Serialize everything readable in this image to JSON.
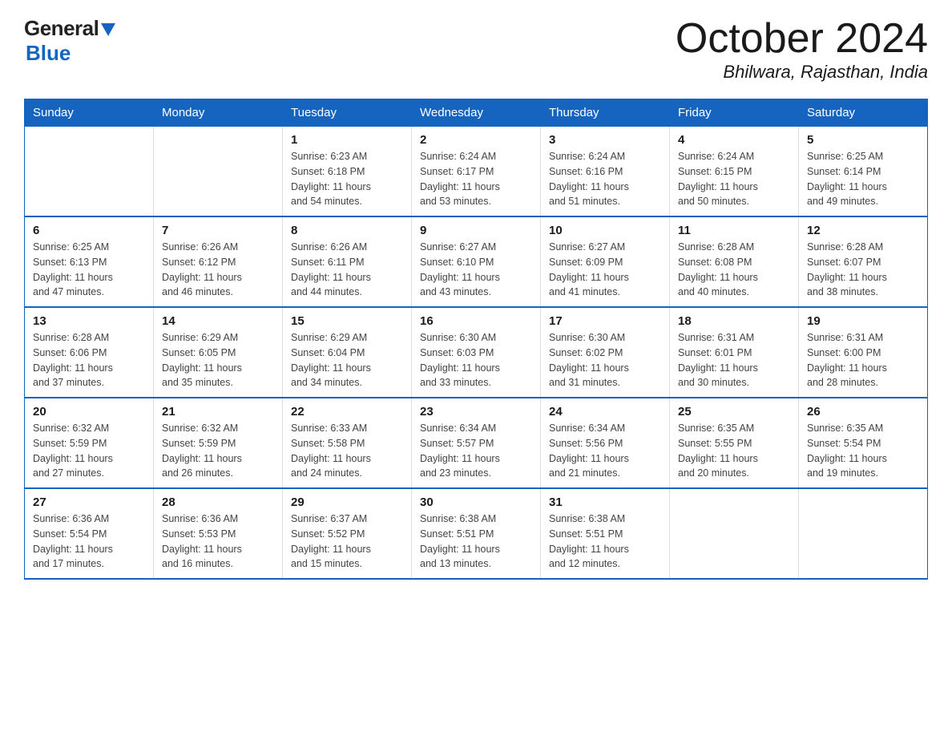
{
  "logo": {
    "general": "General",
    "blue": "Blue"
  },
  "title": "October 2024",
  "location": "Bhilwara, Rajasthan, India",
  "weekdays": [
    "Sunday",
    "Monday",
    "Tuesday",
    "Wednesday",
    "Thursday",
    "Friday",
    "Saturday"
  ],
  "weeks": [
    [
      {
        "day": "",
        "info": ""
      },
      {
        "day": "",
        "info": ""
      },
      {
        "day": "1",
        "info": "Sunrise: 6:23 AM\nSunset: 6:18 PM\nDaylight: 11 hours\nand 54 minutes."
      },
      {
        "day": "2",
        "info": "Sunrise: 6:24 AM\nSunset: 6:17 PM\nDaylight: 11 hours\nand 53 minutes."
      },
      {
        "day": "3",
        "info": "Sunrise: 6:24 AM\nSunset: 6:16 PM\nDaylight: 11 hours\nand 51 minutes."
      },
      {
        "day": "4",
        "info": "Sunrise: 6:24 AM\nSunset: 6:15 PM\nDaylight: 11 hours\nand 50 minutes."
      },
      {
        "day": "5",
        "info": "Sunrise: 6:25 AM\nSunset: 6:14 PM\nDaylight: 11 hours\nand 49 minutes."
      }
    ],
    [
      {
        "day": "6",
        "info": "Sunrise: 6:25 AM\nSunset: 6:13 PM\nDaylight: 11 hours\nand 47 minutes."
      },
      {
        "day": "7",
        "info": "Sunrise: 6:26 AM\nSunset: 6:12 PM\nDaylight: 11 hours\nand 46 minutes."
      },
      {
        "day": "8",
        "info": "Sunrise: 6:26 AM\nSunset: 6:11 PM\nDaylight: 11 hours\nand 44 minutes."
      },
      {
        "day": "9",
        "info": "Sunrise: 6:27 AM\nSunset: 6:10 PM\nDaylight: 11 hours\nand 43 minutes."
      },
      {
        "day": "10",
        "info": "Sunrise: 6:27 AM\nSunset: 6:09 PM\nDaylight: 11 hours\nand 41 minutes."
      },
      {
        "day": "11",
        "info": "Sunrise: 6:28 AM\nSunset: 6:08 PM\nDaylight: 11 hours\nand 40 minutes."
      },
      {
        "day": "12",
        "info": "Sunrise: 6:28 AM\nSunset: 6:07 PM\nDaylight: 11 hours\nand 38 minutes."
      }
    ],
    [
      {
        "day": "13",
        "info": "Sunrise: 6:28 AM\nSunset: 6:06 PM\nDaylight: 11 hours\nand 37 minutes."
      },
      {
        "day": "14",
        "info": "Sunrise: 6:29 AM\nSunset: 6:05 PM\nDaylight: 11 hours\nand 35 minutes."
      },
      {
        "day": "15",
        "info": "Sunrise: 6:29 AM\nSunset: 6:04 PM\nDaylight: 11 hours\nand 34 minutes."
      },
      {
        "day": "16",
        "info": "Sunrise: 6:30 AM\nSunset: 6:03 PM\nDaylight: 11 hours\nand 33 minutes."
      },
      {
        "day": "17",
        "info": "Sunrise: 6:30 AM\nSunset: 6:02 PM\nDaylight: 11 hours\nand 31 minutes."
      },
      {
        "day": "18",
        "info": "Sunrise: 6:31 AM\nSunset: 6:01 PM\nDaylight: 11 hours\nand 30 minutes."
      },
      {
        "day": "19",
        "info": "Sunrise: 6:31 AM\nSunset: 6:00 PM\nDaylight: 11 hours\nand 28 minutes."
      }
    ],
    [
      {
        "day": "20",
        "info": "Sunrise: 6:32 AM\nSunset: 5:59 PM\nDaylight: 11 hours\nand 27 minutes."
      },
      {
        "day": "21",
        "info": "Sunrise: 6:32 AM\nSunset: 5:59 PM\nDaylight: 11 hours\nand 26 minutes."
      },
      {
        "day": "22",
        "info": "Sunrise: 6:33 AM\nSunset: 5:58 PM\nDaylight: 11 hours\nand 24 minutes."
      },
      {
        "day": "23",
        "info": "Sunrise: 6:34 AM\nSunset: 5:57 PM\nDaylight: 11 hours\nand 23 minutes."
      },
      {
        "day": "24",
        "info": "Sunrise: 6:34 AM\nSunset: 5:56 PM\nDaylight: 11 hours\nand 21 minutes."
      },
      {
        "day": "25",
        "info": "Sunrise: 6:35 AM\nSunset: 5:55 PM\nDaylight: 11 hours\nand 20 minutes."
      },
      {
        "day": "26",
        "info": "Sunrise: 6:35 AM\nSunset: 5:54 PM\nDaylight: 11 hours\nand 19 minutes."
      }
    ],
    [
      {
        "day": "27",
        "info": "Sunrise: 6:36 AM\nSunset: 5:54 PM\nDaylight: 11 hours\nand 17 minutes."
      },
      {
        "day": "28",
        "info": "Sunrise: 6:36 AM\nSunset: 5:53 PM\nDaylight: 11 hours\nand 16 minutes."
      },
      {
        "day": "29",
        "info": "Sunrise: 6:37 AM\nSunset: 5:52 PM\nDaylight: 11 hours\nand 15 minutes."
      },
      {
        "day": "30",
        "info": "Sunrise: 6:38 AM\nSunset: 5:51 PM\nDaylight: 11 hours\nand 13 minutes."
      },
      {
        "day": "31",
        "info": "Sunrise: 6:38 AM\nSunset: 5:51 PM\nDaylight: 11 hours\nand 12 minutes."
      },
      {
        "day": "",
        "info": ""
      },
      {
        "day": "",
        "info": ""
      }
    ]
  ]
}
